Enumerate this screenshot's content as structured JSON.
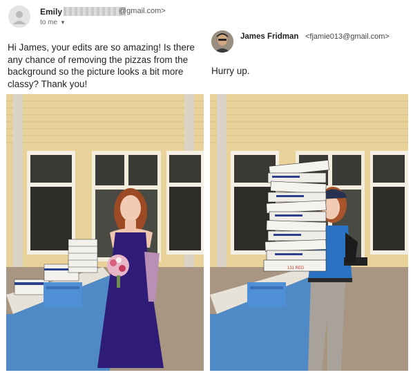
{
  "email": {
    "sender_name": "Emily",
    "sender_domain": "@gmail.com>",
    "recipient": "to me",
    "body": "Hi James, your edits are so amazing! Is there any chance of removing the pizzas from the background so the picture looks a bit more classy? Thank you!"
  },
  "reply": {
    "sender_name": "James Fridman",
    "sender_email": "<fjamie013@gmail.com>",
    "body": "Hurry up."
  },
  "photos": {
    "left_box_label": "",
    "right_box_label": "131 RED"
  },
  "colors": {
    "dress": "#2e1c78",
    "wall": "#e9d39a",
    "table_cloth": "#4d87c6",
    "shirt": "#2a73c4"
  }
}
